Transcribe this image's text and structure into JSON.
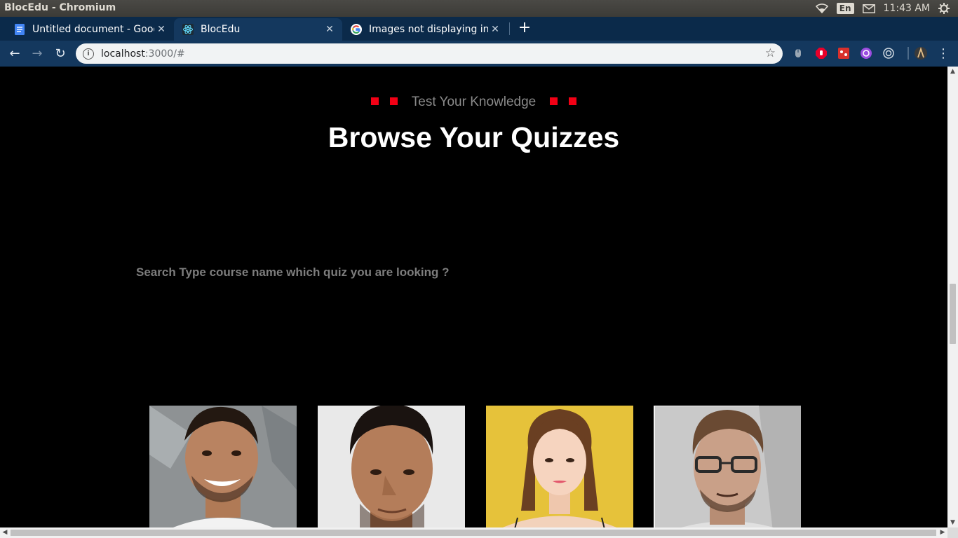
{
  "os": {
    "window_title": "BlocEdu - Chromium",
    "language": "En",
    "time": "11:43 AM"
  },
  "tabs": [
    {
      "label": "Untitled document - Goog",
      "icon": "google-docs-icon",
      "active": false
    },
    {
      "label": "BlocEdu",
      "icon": "react-icon",
      "active": true
    },
    {
      "label": "Images not displaying in (",
      "icon": "google-g-icon",
      "active": false
    }
  ],
  "toolbar": {
    "url_host": "localhost",
    "url_path": ":3000/#",
    "extensions": [
      "mouse-extension-icon",
      "adblock-icon",
      "red-extension-icon",
      "purple-extension-icon",
      "target-extension-icon",
      "avatar-extension-icon"
    ]
  },
  "page": {
    "subtitle": "Test Your Knowledge",
    "heading": "Browse Your Quizzes",
    "search_placeholder": "Search Type course name which quiz you are looking ?",
    "accent_color": "#f20015",
    "cards": [
      {
        "name": "instructor-photo-1"
      },
      {
        "name": "instructor-photo-2"
      },
      {
        "name": "instructor-photo-3"
      },
      {
        "name": "instructor-photo-4"
      }
    ]
  }
}
